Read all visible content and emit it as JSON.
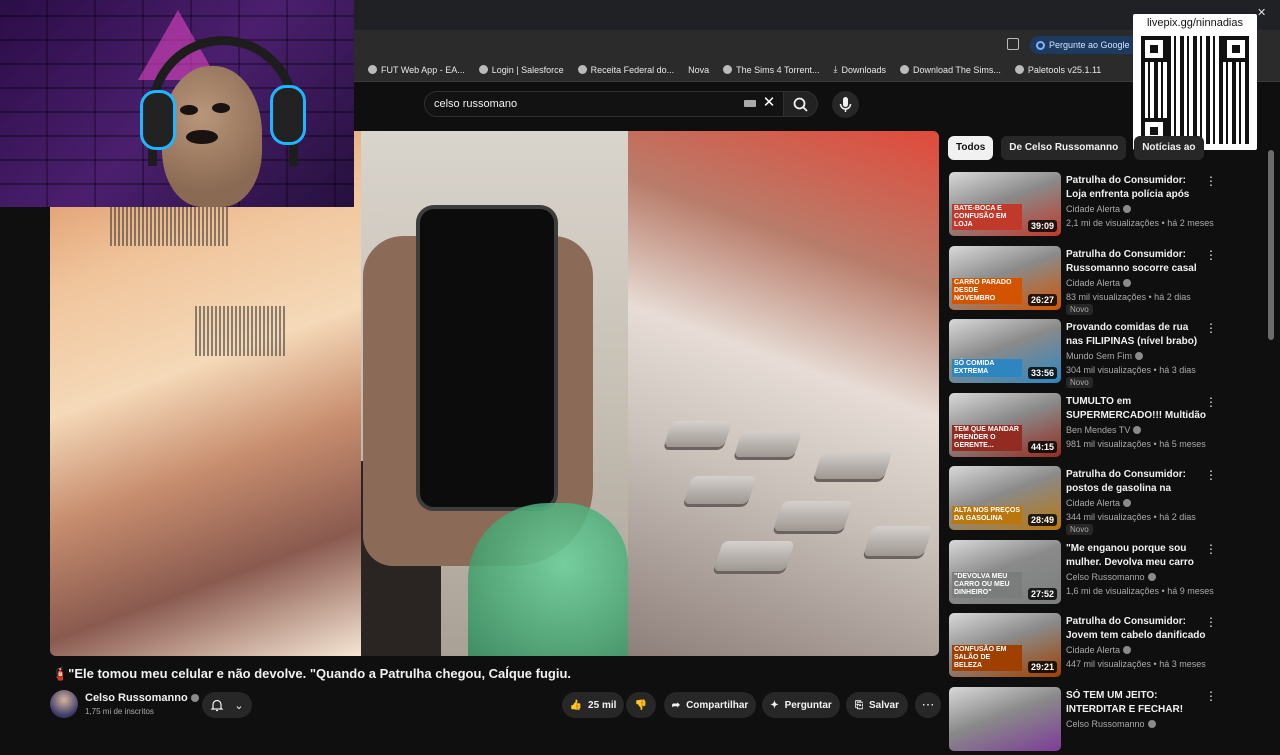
{
  "browser": {
    "ask_google": "Pergunte ao Google",
    "bookmarks": [
      {
        "label": "FUT Web App - EA..."
      },
      {
        "label": "Login | Salesforce"
      },
      {
        "label": "Receita Federal do..."
      },
      {
        "label": "Nova"
      },
      {
        "label": "The Sims 4 Torrent..."
      },
      {
        "label": "Downloads"
      },
      {
        "label": "Download The Sims..."
      },
      {
        "label": "Paletools v25.1.11"
      }
    ]
  },
  "search": {
    "query": "celso russomano"
  },
  "overlay": {
    "livepix": "livepix.gg/ninnadias"
  },
  "video": {
    "title": "🧯\"Ele tomou meu celular e não devolve. \"Quando a Patrulha chegou, CaÍque fugiu.",
    "channel": "Celso Russomanno",
    "subscribers": "1,75 mi de inscritos",
    "likes": "25 mil",
    "share_label": "Compartilhar",
    "ask_label": "Perguntar",
    "save_label": "Salvar"
  },
  "chips": [
    {
      "label": "Todos",
      "active": true
    },
    {
      "label": "De Celso Russomanno",
      "active": false
    },
    {
      "label": "Notícias ao",
      "active": false
    }
  ],
  "recommendations": [
    {
      "title": "Patrulha do Consumidor: Loja enfrenta polícia após emitir ...",
      "channel": "Cidade Alerta",
      "meta": "2,1 mi de visualizações • há 2 meses",
      "duration": "39:09",
      "new": "",
      "thumb_text": "BATE-BOCA E CONFUSÃO EM LOJA",
      "color": "#c0392b"
    },
    {
      "title": "Patrulha do Consumidor: Russomanno socorre casal de...",
      "channel": "Cidade Alerta",
      "meta": "83 mil visualizações • há 2 dias",
      "duration": "26:27",
      "new": "Novo",
      "thumb_text": "CARRO PARADO DESDE NOVEMBRO",
      "color": "#d35400"
    },
    {
      "title": "Provando comidas de rua nas FILIPINAS (nível brabo)",
      "channel": "Mundo Sem Fim",
      "meta": "304 mil visualizações • há 3 dias",
      "duration": "33:56",
      "new": "Novo",
      "thumb_text": "SÓ COMIDA EXTREMA",
      "color": "#2e86c1"
    },
    {
      "title": "TUMULTO em SUPERMERCADO!!! Multidão ...",
      "channel": "Ben Mendes TV",
      "meta": "981 mil visualizações • há 5 meses",
      "duration": "44:15",
      "new": "",
      "thumb_text": "TEM QUE MANDAR PRENDER O GERENTE...",
      "color": "#922b21"
    },
    {
      "title": "Patrulha do Consumidor: postos de gasolina na Grande SP têm ...",
      "channel": "Cidade Alerta",
      "meta": "344 mil visualizações • há 2 dias",
      "duration": "28:49",
      "new": "Novo",
      "thumb_text": "ALTA NOS PREÇOS DA GASOLINA",
      "color": "#b9770e"
    },
    {
      "title": "\"Me enganou porque sou mulher. Devolva meu carro ou ...",
      "channel": "Celso Russomanno",
      "meta": "1,6 mi de visualizações • há 9 meses",
      "duration": "27:52",
      "new": "",
      "thumb_text": "\"DEVOLVA MEU CARRO OU MEU DINHEIRO\"",
      "color": "#7b7d7d"
    },
    {
      "title": "Patrulha do Consumidor: Jovem tem cabelo danificado no salã...",
      "channel": "Cidade Alerta",
      "meta": "447 mil visualizações • há 3 meses",
      "duration": "29:21",
      "new": "",
      "thumb_text": "CONFUSÃO EM SALÃO DE BELEZA",
      "color": "#a04000"
    },
    {
      "title": "SÓ TEM UM JEITO: INTERDITAR E FECHAR! BLITZ EM ...",
      "channel": "Celso Russomanno",
      "meta": "",
      "duration": "",
      "new": "",
      "thumb_text": "",
      "color": "#7d3c98"
    }
  ]
}
